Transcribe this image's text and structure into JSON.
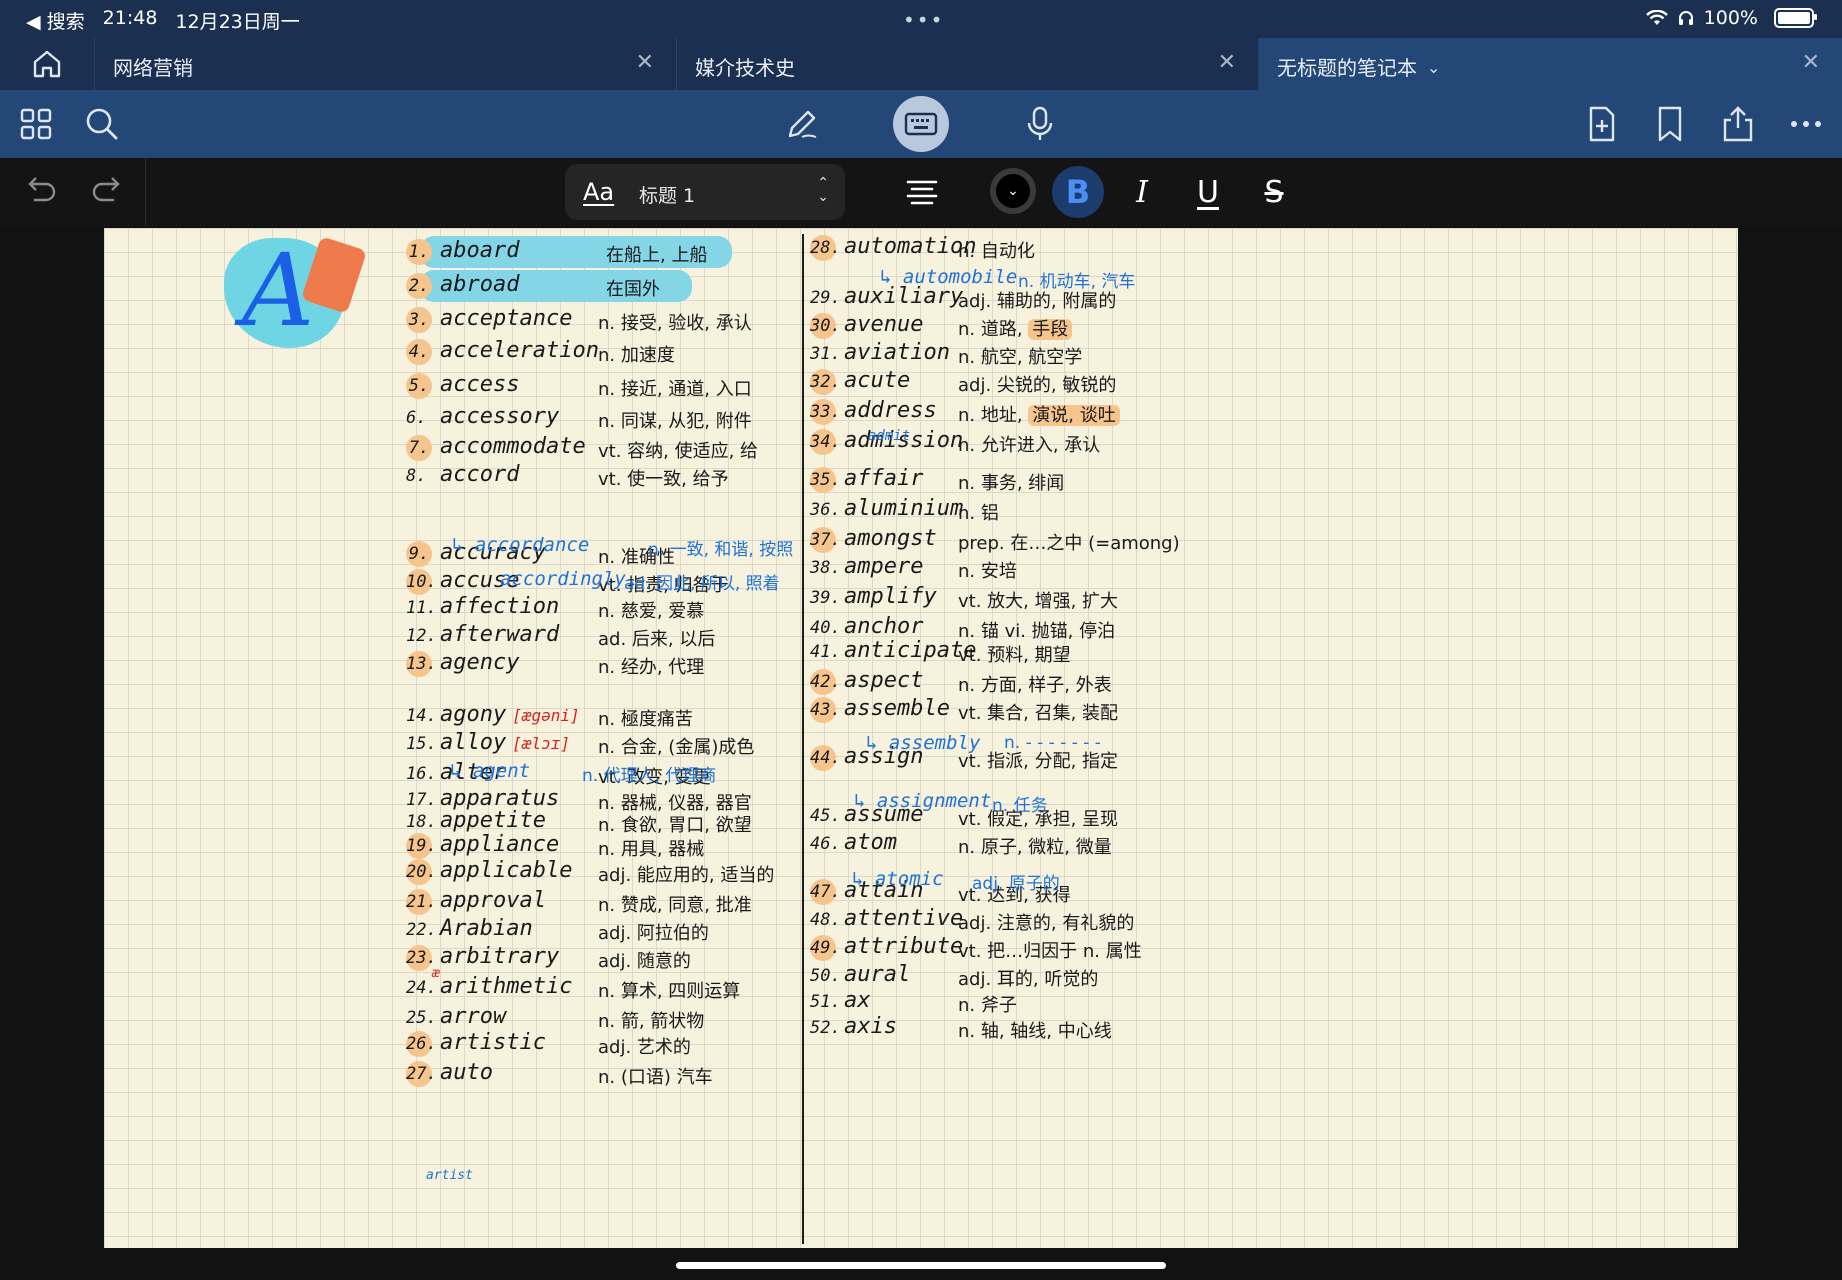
{
  "status": {
    "back_label": "◀ 搜索",
    "time": "21:48",
    "date": "12月23日周一",
    "battery": "100%"
  },
  "tabs": [
    {
      "label": "网络营销"
    },
    {
      "label": "媒介技术史"
    },
    {
      "label": "无标题的笔记本"
    }
  ],
  "format": {
    "aa": "Aa",
    "style_name": "标题 1",
    "bold": "B",
    "italic": "I",
    "underline": "U",
    "strike": "S"
  },
  "note": {
    "big_letter": "A",
    "left_column": [
      {
        "num": "1.",
        "word": "aboard",
        "def": "在船上, 上船",
        "hl": true
      },
      {
        "num": "2.",
        "word": "abroad",
        "def": "在国外",
        "hl": true
      },
      {
        "num": "3.",
        "word": "acceptance",
        "def": "n. 接受, 验收, 承认"
      },
      {
        "num": "4.",
        "word": "acceleration",
        "def": "n. 加速度"
      },
      {
        "num": "5.",
        "word": "access",
        "def": "n. 接近, 通道, 入口"
      },
      {
        "num": "6.",
        "word": "accessory",
        "def": "n. 同谋, 从犯, 附件"
      },
      {
        "num": "7.",
        "word": "accommodate",
        "def": "vt. 容纳, 使适应, 给"
      },
      {
        "num": "8.",
        "word": "accord",
        "def": "vt. 使一致, 给予"
      },
      {
        "num": "9.",
        "word": "accuracy",
        "def": "n. 准确性"
      },
      {
        "num": "10.",
        "word": "accuse",
        "def": "vt. 指责, 归咎于"
      },
      {
        "num": "11.",
        "word": "affection",
        "def": "n. 慈爱, 爱慕"
      },
      {
        "num": "12.",
        "word": "afterward",
        "def": "ad. 后来, 以后"
      },
      {
        "num": "13.",
        "word": "agency",
        "def": "n. 经办, 代理"
      },
      {
        "num": "14.",
        "word": "agony",
        "ipa": "[ægəni]",
        "def": "n. 極度痛苦"
      },
      {
        "num": "15.",
        "word": "alloy",
        "ipa": "[ælɔɪ]",
        "def": "n. 合金, (金属)成色"
      },
      {
        "num": "16.",
        "word": "alter",
        "def": "vt. 改变, 变更"
      },
      {
        "num": "17.",
        "word": "apparatus",
        "def": "n. 器械, 仪器, 器官"
      },
      {
        "num": "18.",
        "word": "appetite",
        "def": "n. 食欲, 胃口, 欲望"
      },
      {
        "num": "19.",
        "word": "appliance",
        "def": "n. 用具, 器械"
      },
      {
        "num": "20.",
        "word": "applicable",
        "def": "adj. 能应用的, 适当的"
      },
      {
        "num": "21.",
        "word": "approval",
        "def": "n. 赞成, 同意, 批准"
      },
      {
        "num": "22.",
        "word": "Arabian",
        "def": "adj. 阿拉伯的"
      },
      {
        "num": "23.",
        "word": "arbitrary",
        "def": "adj. 随意的"
      },
      {
        "num": "24.",
        "word": "arithmetic",
        "def": "n. 算术, 四则运算"
      },
      {
        "num": "25.",
        "word": "arrow",
        "def": "n. 箭, 箭状物"
      },
      {
        "num": "26.",
        "word": "artistic",
        "def": "adj. 艺术的"
      },
      {
        "num": "27.",
        "word": "auto",
        "def": "n. (口语) 汽车"
      }
    ],
    "left_subs": [
      {
        "word": "accordance",
        "def": "n. 一致, 和谐, 按照"
      },
      {
        "word": "accordingly",
        "def": "ad. 因此, 所以, 照着"
      },
      {
        "word": "agent",
        "def": "n. 代理人, 代理商"
      }
    ],
    "right_column": [
      {
        "num": "28.",
        "word": "automation",
        "def": "n. 自动化"
      },
      {
        "num": "29.",
        "word": "auxiliary",
        "def": "adj. 辅助的, 附属的"
      },
      {
        "num": "30.",
        "word": "avenue",
        "def": "n. 道路, ",
        "def_hl": "手段"
      },
      {
        "num": "31.",
        "word": "aviation",
        "def": "n. 航空, 航空学"
      },
      {
        "num": "32.",
        "word": "acute",
        "def": "adj. 尖锐的, 敏锐的"
      },
      {
        "num": "33.",
        "word": "address",
        "def": "n. 地址, ",
        "def_hl": "演说, 谈吐"
      },
      {
        "num": "34.",
        "word": "admission",
        "def": "n. 允许进入, 承认"
      },
      {
        "num": "35.",
        "word": "affair",
        "def": "n. 事务, 绯闻"
      },
      {
        "num": "36.",
        "word": "aluminium",
        "def": "n. 铝"
      },
      {
        "num": "37.",
        "word": "amongst",
        "def": "prep. 在…之中 (=among)"
      },
      {
        "num": "38.",
        "word": "ampere",
        "def": "n. 安培"
      },
      {
        "num": "39.",
        "word": "amplify",
        "def": "vt. 放大, 增强, 扩大"
      },
      {
        "num": "40.",
        "word": "anchor",
        "def": "n. 锚 vi. 抛锚, 停泊"
      },
      {
        "num": "41.",
        "word": "anticipate",
        "def": "vt. 预料, 期望"
      },
      {
        "num": "42.",
        "word": "aspect",
        "def": "n. 方面, 样子, 外表"
      },
      {
        "num": "43.",
        "word": "assemble",
        "def": "vt. 集合, 召集, 装配"
      },
      {
        "num": "44.",
        "word": "assign",
        "def": "vt. 指派, 分配, 指定"
      },
      {
        "num": "45.",
        "word": "assume",
        "def": "vt. 假定, 承担, 呈现"
      },
      {
        "num": "46.",
        "word": "atom",
        "def": "n. 原子, 微粒, 微量"
      },
      {
        "num": "47.",
        "word": "attain",
        "def": "vt. 达到, 获得"
      },
      {
        "num": "48.",
        "word": "attentive",
        "def": "adj. 注意的, 有礼貌的"
      },
      {
        "num": "49.",
        "word": "attribute",
        "def": "vt. 把…归因于 n. 属性"
      },
      {
        "num": "50.",
        "word": "aural",
        "def": "adj. 耳的, 听觉的"
      },
      {
        "num": "51.",
        "word": "ax",
        "def": "n. 斧子"
      },
      {
        "num": "52.",
        "word": "axis",
        "def": "n. 轴, 轴线, 中心线"
      }
    ],
    "right_subs": [
      {
        "word": "automobile",
        "def": "n. 机动车, 汽车"
      },
      {
        "word": "assembly",
        "def": "n. - - - - - - -"
      },
      {
        "word": "assignment",
        "def": "n. 任务"
      },
      {
        "word": "atomic",
        "def": "adj. 原子的"
      }
    ],
    "annotations": {
      "admit": "admit",
      "artist": "artist",
      "ae": "æ"
    }
  }
}
